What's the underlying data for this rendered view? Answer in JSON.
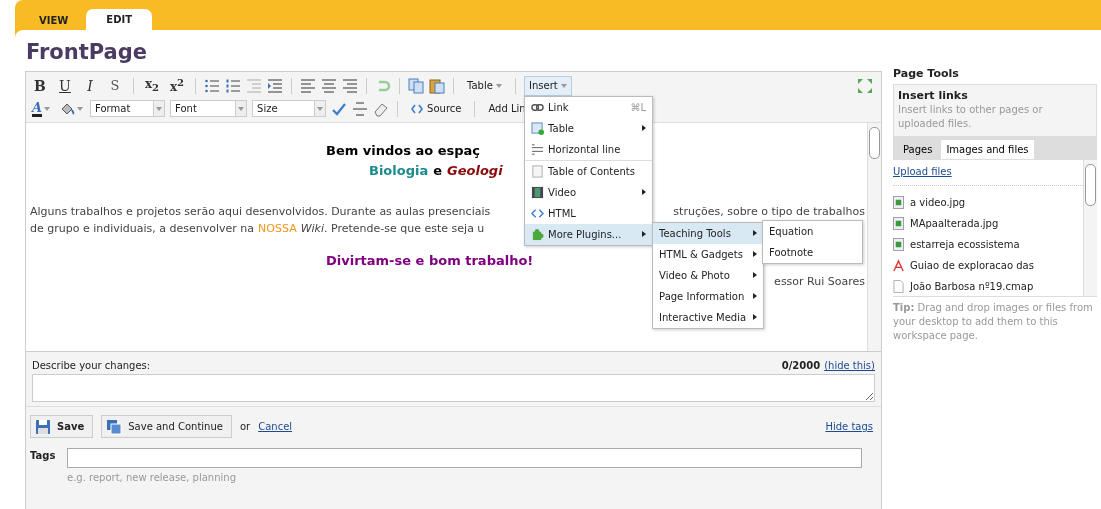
{
  "tabs": [
    {
      "label": "VIEW",
      "selected": false
    },
    {
      "label": "EDIT",
      "selected": true
    }
  ],
  "page_title": "FrontPage",
  "toolbar": {
    "format_buttons": [
      {
        "label": "B",
        "kind": "bold"
      },
      {
        "label": "U",
        "kind": "underline"
      },
      {
        "label": "I",
        "kind": "italic"
      },
      {
        "label": "S",
        "kind": "strike"
      },
      {
        "label": "x$_{2}$",
        "kind": "script"
      },
      {
        "label": "x$^{2}$",
        "kind": "script"
      }
    ],
    "text_color_label": "A",
    "selects": [
      {
        "value": "Format"
      },
      {
        "value": "Font"
      },
      {
        "value": "Size"
      }
    ],
    "table_button": "Table",
    "insert_button": {
      "label": "Insert",
      "open": true
    },
    "source_button": "Source",
    "add_link_button": "Add Lin"
  },
  "insert_menu": [
    {
      "label": "Link",
      "shortcut": "⌘L",
      "submenu": false,
      "selected": false
    },
    {
      "label": "Table",
      "submenu": true,
      "selected": false
    },
    {
      "label": "Horizontal line",
      "submenu": false,
      "selected": false
    },
    {
      "label": "Table of Contents",
      "submenu": false,
      "selected": false
    },
    {
      "label": "Video",
      "submenu": true,
      "selected": false
    },
    {
      "label": "HTML",
      "submenu": false,
      "selected": false
    },
    {
      "label": "More Plugins...",
      "submenu": true,
      "selected": true
    }
  ],
  "plugins_menu": [
    {
      "label": "Teaching Tools",
      "selected": true
    },
    {
      "label": "HTML & Gadgets",
      "selected": false
    },
    {
      "label": "Video & Photo",
      "selected": false
    },
    {
      "label": "Page Information",
      "selected": false
    },
    {
      "label": "Interactive Media",
      "selected": false
    }
  ],
  "teaching_menu": [
    "Equation",
    "Footnote"
  ],
  "content": {
    "heading": "Bem vindos ao espaç",
    "subheading": [
      {
        "text": "Biologia",
        "color": "#1b8a8c"
      },
      {
        "text": "e",
        "color": "#000000"
      },
      {
        "text": "*Geologi*",
        "color": "#8b0a0a"
      }
    ],
    "paragraph_line_1": "Alguns trabalhos e projetos serão aqui desenvolvidos. Durante as aulas presenciais",
    "paragraph_line_1_end": "struções, sobre o tipo de trabalhos",
    "paragraph_line_2": [
      {
        "text": "de grupo e individuais, a desenvolver na",
        "color": "#444444"
      },
      {
        "text": "NOSSA",
        "color": "#f7941d"
      },
      {
        "text": "*Wiki*. Pretende-se que este seja u",
        "color": "#444444"
      }
    ],
    "closing": "Divirtam-se e bom trabalho!",
    "signature": "essor Rui Soares"
  },
  "changes": {
    "label": "Describe your changes:",
    "counter": "0/2000",
    "hide_link": "(hide this)"
  },
  "actions": {
    "save": "Save",
    "save_continue": "Save and Continue",
    "or": "or",
    "cancel": "Cancel",
    "hide_tags": "Hide tags"
  },
  "tags": {
    "label": "Tags",
    "hint": "e.g. report, new release, planning"
  },
  "sidebar": {
    "title": "Page Tools",
    "box_title": "Insert links",
    "box_text": "Insert links to other pages or uploaded files.",
    "tabs": [
      {
        "label": "Pages",
        "selected": false
      },
      {
        "label": "Images and files",
        "selected": true
      }
    ],
    "upload": "Upload files",
    "files": [
      {
        "name": "a video.jpg",
        "kind": "image"
      },
      {
        "name": "MApaalterada.jpg",
        "kind": "image"
      },
      {
        "name": "estarreja ecossistema",
        "kind": "image"
      },
      {
        "name": "Guiao de exploracao das",
        "kind": "pdf"
      },
      {
        "name": "João Barbosa nº19.cmap",
        "kind": "file"
      }
    ],
    "tip": "**Tip:**  Drag and drop images or files from your desktop to add them to this workspace page."
  }
}
